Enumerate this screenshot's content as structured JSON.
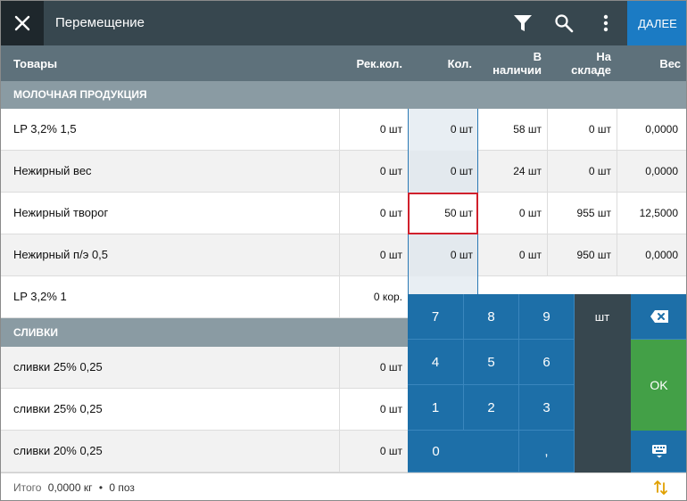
{
  "topbar": {
    "title": "Перемещение",
    "next_label": "ДАЛЕЕ",
    "icons": [
      "close-icon",
      "filter-icon",
      "search-icon",
      "more-vert-icon"
    ]
  },
  "columns": {
    "goods": "Товары",
    "rec_qty": "Рек.кол.",
    "qty": "Кол.",
    "in_stock_1": "В",
    "in_stock_2": "наличии",
    "warehouse_1": "На",
    "warehouse_2": "складе",
    "weight": "Вес"
  },
  "groups": [
    {
      "name": "МОЛОЧНАЯ ПРОДУКЦИЯ"
    },
    {
      "name": "СЛИВКИ"
    }
  ],
  "rows": [
    {
      "name": "LP 3,2% 1,5",
      "rec": "0 шт",
      "qty": "0 шт",
      "stock": "58 шт",
      "wh": "0 шт",
      "weight": "0,0000"
    },
    {
      "name": "Нежирный вес",
      "rec": "0 шт",
      "qty": "0 шт",
      "stock": "24 шт",
      "wh": "0 шт",
      "weight": "0,0000"
    },
    {
      "name": "Нежирный творог",
      "rec": "0 шт",
      "qty": "50 шт",
      "stock": "0 шт",
      "wh": "955 шт",
      "weight": "12,5000"
    },
    {
      "name": "Нежирный п/э 0,5",
      "rec": "0 шт",
      "qty": "0 шт",
      "stock": "0 шт",
      "wh": "950 шт",
      "weight": "0,0000"
    },
    {
      "name": "LP 3,2% 1",
      "rec": "0 кор."
    },
    {
      "name": "сливки 25% 0,25",
      "rec": "0 шт"
    },
    {
      "name": "сливки 25% 0,25",
      "rec": "0 шт"
    },
    {
      "name": "сливки 20% 0,25",
      "rec": "0 шт"
    }
  ],
  "keypad": {
    "k7": "7",
    "k8": "8",
    "k9": "9",
    "unit": "шт",
    "k4": "4",
    "k5": "5",
    "k6": "6",
    "ok": "OK",
    "k1": "1",
    "k2": "2",
    "k3": "3",
    "k0": "0",
    "comma": ",",
    "icons": [
      "backspace-icon",
      "keyboard-icon"
    ]
  },
  "footer": {
    "total_label": "Итого",
    "total_weight": "0,0000 кг",
    "separator": "•",
    "positions": "0 поз",
    "icon": "sort-icon"
  },
  "colors": {
    "topbar": "#37474f",
    "accent": "#1b7bc4",
    "header": "#5e717b",
    "group": "#8a9ba3",
    "ok": "#43a047",
    "active_border": "#d0202c"
  }
}
